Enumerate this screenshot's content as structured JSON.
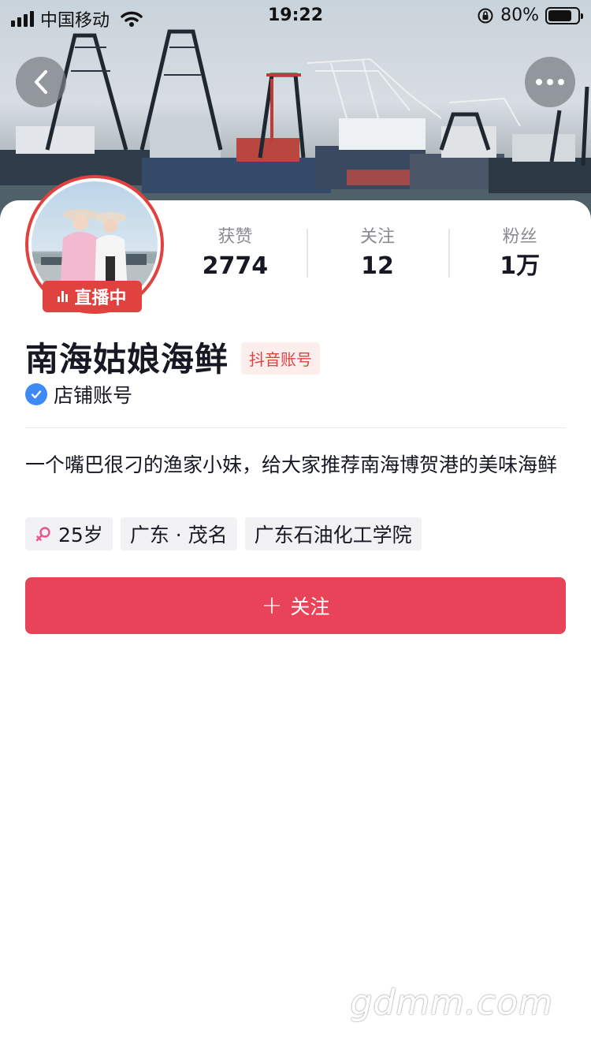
{
  "status_bar": {
    "carrier": "中国移动",
    "time": "19:22",
    "battery_text": "80%",
    "battery_level": 0.8
  },
  "nav": {
    "back_icon": "chevron-left-icon",
    "more_icon": "more-horizontal-icon"
  },
  "profile": {
    "live_label": "直播中",
    "name": "南海姑娘海鲜",
    "account_tag": "抖音账号",
    "verify_label": "店铺账号",
    "bio": "一个嘴巴很刁的渔家小妹，给大家推荐南海博贺港的美味海鲜"
  },
  "stats": [
    {
      "label": "获赞",
      "value": "2774"
    },
    {
      "label": "关注",
      "value": "12"
    },
    {
      "label": "粉丝",
      "value": "1万"
    }
  ],
  "tags": {
    "age": "25岁",
    "location": "广东 · 茂名",
    "school": "广东石油化工学院"
  },
  "follow_button": {
    "label": "关注",
    "color": "#e9435a"
  },
  "watermark": "gdmm.com",
  "colors": {
    "accent": "#e0433f",
    "verify": "#3d8af7",
    "female": "#e8558a"
  }
}
